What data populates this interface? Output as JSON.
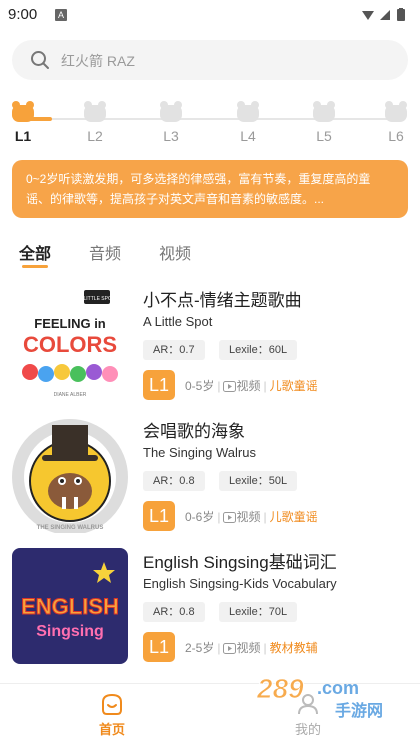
{
  "status_bar": {
    "time": "9:00",
    "notif_letter": "A"
  },
  "search": {
    "placeholder": "红火箭 RAZ"
  },
  "levels": {
    "items": [
      {
        "label": "L1",
        "active": true
      },
      {
        "label": "L2",
        "active": false
      },
      {
        "label": "L3",
        "active": false
      },
      {
        "label": "L4",
        "active": false
      },
      {
        "label": "L5",
        "active": false
      },
      {
        "label": "L6",
        "active": false
      }
    ]
  },
  "banner": {
    "line1": "0~2岁听读激发期，可多选择的律感强，富有节奏，重复度高的童",
    "line2": "谣、的律歌等，提高孩子对英文声音和音素的敏感度。..."
  },
  "tabs": {
    "all": "全部",
    "audio": "音频",
    "video": "视频"
  },
  "items": [
    {
      "title": "小不点-情绪主题歌曲",
      "subtitle": "A Little Spot",
      "ar": "AR：0.7",
      "lexile": "Lexile：60L",
      "level": "L1",
      "age": "0-5岁",
      "type": "视频",
      "category": "儿歌童谣",
      "thumb": {
        "line1": "FEELING in",
        "line2": "COLORS",
        "corner": "A LITTLE SPOT",
        "author": "DIANE ALBER"
      }
    },
    {
      "title": "会唱歌的海象",
      "subtitle": "The Singing Walrus",
      "ar": "AR：0.8",
      "lexile": "Lexile：50L",
      "level": "L1",
      "age": "0-6岁",
      "type": "视频",
      "category": "儿歌童谣",
      "thumb": {
        "ring": "THE SINGING WALRUS"
      }
    },
    {
      "title": "English Singsing基础词汇",
      "subtitle": "English Singsing-Kids Vocabulary",
      "ar": "AR：0.8",
      "lexile": "Lexile：70L",
      "level": "L1",
      "age": "2-5岁",
      "type": "视频",
      "category": "教材教辅",
      "thumb": {
        "line1": "ENGLISH",
        "line2": "Singsing"
      }
    }
  ],
  "nav": {
    "home": "首页",
    "mine": "我的"
  },
  "watermark": {
    "brand": "289",
    "domain": ".com",
    "sub": "手游网"
  },
  "colors": {
    "accent": "#f7a23b",
    "accent_text": "#f08a1c",
    "banner": "#f7a449"
  }
}
